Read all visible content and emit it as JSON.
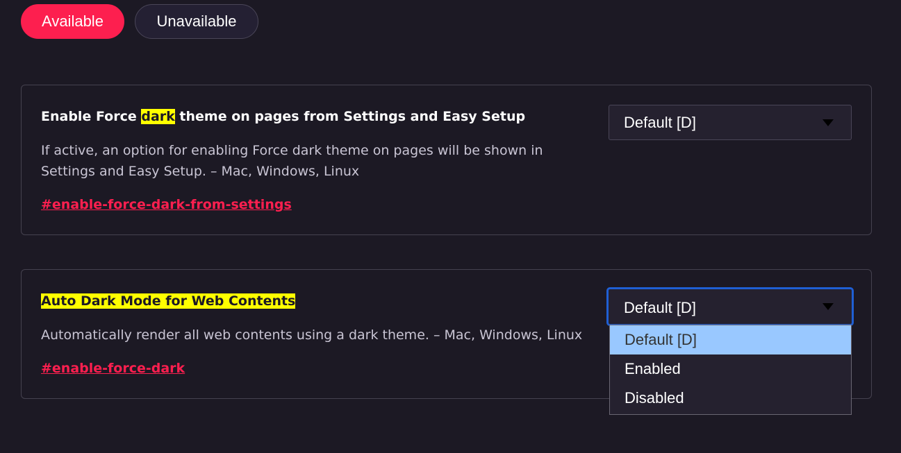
{
  "tabs": {
    "available": "Available",
    "unavailable": "Unavailable"
  },
  "experiments": [
    {
      "title_prefix": "Enable Force ",
      "title_highlight": "dark",
      "title_suffix": " theme on pages from Settings and Easy Setup",
      "description": "If active, an option for enabling Force dark theme on pages will be shown in Settings and Easy Setup. – Mac, Windows, Linux",
      "link": "#enable-force-dark-from-settings",
      "select_value": "Default [D]"
    },
    {
      "title_prefix": "Auto ",
      "title_highlight": "Dark",
      "title_suffix": " Mode for Web Contents",
      "description": "Automatically render all web contents using a dark theme. – Mac, Windows, Linux",
      "link": "#enable-force-dark",
      "select_value": "Default [D]"
    }
  ],
  "dropdown": {
    "options": [
      "Default [D]",
      "Enabled",
      "Disabled"
    ],
    "selected_index": 0
  },
  "colors": {
    "background": "#1c1924",
    "accent": "#fd1f4f",
    "highlight": "#ffff00",
    "focus_border": "#1f5fd4",
    "option_selected": "#99c8ff"
  },
  "icons": {
    "select_caret": "triangle-down-icon"
  }
}
